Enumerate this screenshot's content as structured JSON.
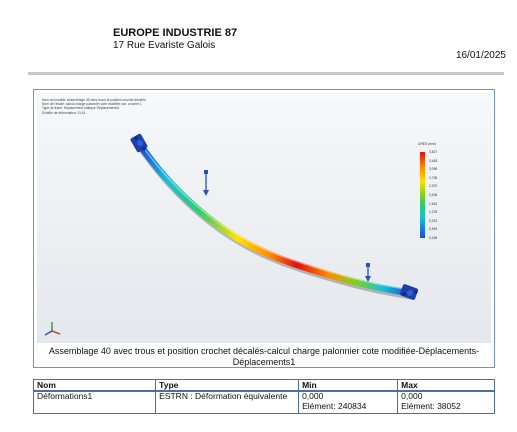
{
  "header": {
    "company": "EUROPE INDUSTRIE 87",
    "address": "17 Rue Evariste Galois",
    "date": "16/01/2025"
  },
  "plot": {
    "info_lines": [
      "Nom du modèle: Assemblage 40 avec trous et position crochet décalés",
      "Nom de l'étude: calcul charge palonnier cote modifiée-var- crochet 1",
      "Type de tracé: Déplacement statique Déplacements1",
      "Echelle de déformation: 11,61"
    ],
    "legend": {
      "title": "URES (mm)",
      "ticks": [
        "3,827",
        "3,463",
        "3,099",
        "2,735",
        "2,370",
        "2,006",
        "1,642",
        "1,278",
        "0,913",
        "0,549",
        "0,185"
      ]
    },
    "colors": {
      "high": "#e01010",
      "mid": "#7ed321",
      "low": "#1a4ed8"
    },
    "caption": "Assemblage 40 avec trous et position crochet décalés-calcul charge palonnier cote modifiée-Déplacements-Déplacements1"
  },
  "table": {
    "headers": [
      "Nom",
      "Type",
      "Min",
      "Max"
    ],
    "rows": [
      {
        "name": "Déformations1",
        "type": "ESTRN : Déformation équivalente",
        "min_value": "0,000",
        "min_element": "Elément: 240834",
        "max_value": "0,000",
        "max_element": "Elément: 38052"
      }
    ]
  }
}
